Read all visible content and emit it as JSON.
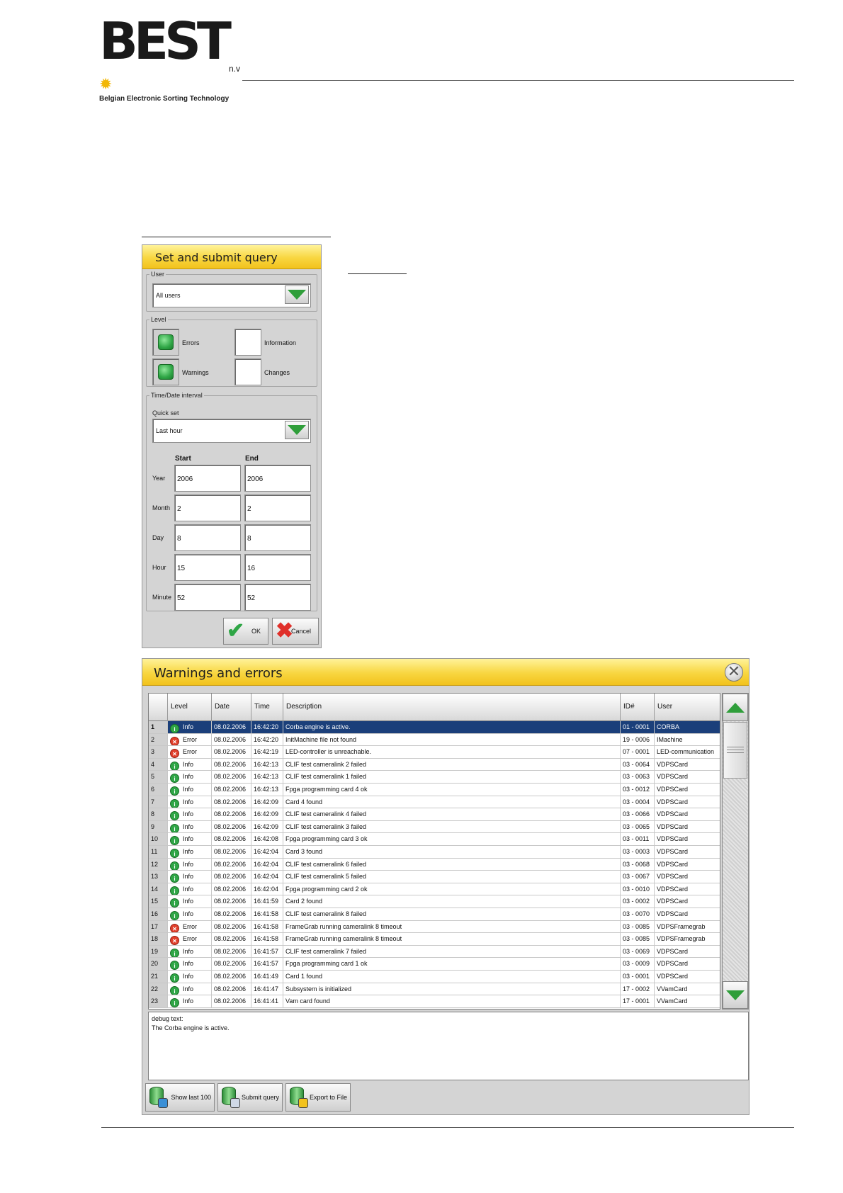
{
  "header": {
    "logo_text": "BEST",
    "logo_suffix": "n.v",
    "tagline": "Belgian Electronic Sorting Technology"
  },
  "query_panel": {
    "title": "Set  and submit query",
    "user_group_label": "User",
    "user_value": "All users",
    "level_group_label": "Level",
    "levels": [
      {
        "label": "Errors",
        "checked": true
      },
      {
        "label": "Information",
        "checked": false
      },
      {
        "label": "Warnings",
        "checked": true
      },
      {
        "label": "Changes",
        "checked": false
      }
    ],
    "interval_group_label": "Time/Date interval",
    "quick_set_label": "Quick set",
    "quick_set_value": "Last hour",
    "start_label": "Start",
    "end_label": "End",
    "rows": [
      {
        "label": "Year",
        "start": "2006",
        "end": "2006"
      },
      {
        "label": "Month",
        "start": "2",
        "end": "2"
      },
      {
        "label": "Day",
        "start": "8",
        "end": "8"
      },
      {
        "label": "Hour",
        "start": "15",
        "end": "16"
      },
      {
        "label": "Minute",
        "start": "52",
        "end": "52"
      }
    ],
    "ok_label": "OK",
    "cancel_label": "Cancel"
  },
  "warnings_panel": {
    "title": "Warnings and errors",
    "columns": [
      "Level",
      "Date",
      "Time",
      "Description",
      "ID#",
      "User"
    ],
    "rows": [
      {
        "n": "1",
        "level": "Info",
        "date": "08.02.2006",
        "time": "16:42:20",
        "desc": "Corba engine is active.",
        "id": "01 - 0001",
        "user": "CORBA"
      },
      {
        "n": "2",
        "level": "Error",
        "date": "08.02.2006",
        "time": "16:42:20",
        "desc": "InitMachine file not found",
        "id": "19 - 0006",
        "user": "IMachine"
      },
      {
        "n": "3",
        "level": "Error",
        "date": "08.02.2006",
        "time": "16:42:19",
        "desc": "LED-controller is unreachable.",
        "id": "07 - 0001",
        "user": "LED-communication"
      },
      {
        "n": "4",
        "level": "Info",
        "date": "08.02.2006",
        "time": "16:42:13",
        "desc": "CLIF test cameralink 2 failed",
        "id": "03 - 0064",
        "user": "VDPSCard"
      },
      {
        "n": "5",
        "level": "Info",
        "date": "08.02.2006",
        "time": "16:42:13",
        "desc": "CLIF test cameralink 1 failed",
        "id": "03 - 0063",
        "user": "VDPSCard"
      },
      {
        "n": "6",
        "level": "Info",
        "date": "08.02.2006",
        "time": "16:42:13",
        "desc": "Fpga programming card 4 ok",
        "id": "03 - 0012",
        "user": "VDPSCard"
      },
      {
        "n": "7",
        "level": "Info",
        "date": "08.02.2006",
        "time": "16:42:09",
        "desc": "Card 4 found",
        "id": "03 - 0004",
        "user": "VDPSCard"
      },
      {
        "n": "8",
        "level": "Info",
        "date": "08.02.2006",
        "time": "16:42:09",
        "desc": "CLIF test cameralink 4 failed",
        "id": "03 - 0066",
        "user": "VDPSCard"
      },
      {
        "n": "9",
        "level": "Info",
        "date": "08.02.2006",
        "time": "16:42:09",
        "desc": "CLIF test cameralink 3 failed",
        "id": "03 - 0065",
        "user": "VDPSCard"
      },
      {
        "n": "10",
        "level": "Info",
        "date": "08.02.2006",
        "time": "16:42:08",
        "desc": "Fpga programming card 3 ok",
        "id": "03 - 0011",
        "user": "VDPSCard"
      },
      {
        "n": "11",
        "level": "Info",
        "date": "08.02.2006",
        "time": "16:42:04",
        "desc": "Card 3 found",
        "id": "03 - 0003",
        "user": "VDPSCard"
      },
      {
        "n": "12",
        "level": "Info",
        "date": "08.02.2006",
        "time": "16:42:04",
        "desc": "CLIF test cameralink 6 failed",
        "id": "03 - 0068",
        "user": "VDPSCard"
      },
      {
        "n": "13",
        "level": "Info",
        "date": "08.02.2006",
        "time": "16:42:04",
        "desc": "CLIF test cameralink 5 failed",
        "id": "03 - 0067",
        "user": "VDPSCard"
      },
      {
        "n": "14",
        "level": "Info",
        "date": "08.02.2006",
        "time": "16:42:04",
        "desc": "Fpga programming card 2 ok",
        "id": "03 - 0010",
        "user": "VDPSCard"
      },
      {
        "n": "15",
        "level": "Info",
        "date": "08.02.2006",
        "time": "16:41:59",
        "desc": "Card 2 found",
        "id": "03 - 0002",
        "user": "VDPSCard"
      },
      {
        "n": "16",
        "level": "Info",
        "date": "08.02.2006",
        "time": "16:41:58",
        "desc": "CLIF test cameralink 8 failed",
        "id": "03 - 0070",
        "user": "VDPSCard"
      },
      {
        "n": "17",
        "level": "Error",
        "date": "08.02.2006",
        "time": "16:41:58",
        "desc": "FrameGrab running cameralink 8 timeout",
        "id": "03 - 0085",
        "user": "VDPSFramegrab"
      },
      {
        "n": "18",
        "level": "Error",
        "date": "08.02.2006",
        "time": "16:41:58",
        "desc": "FrameGrab running cameralink 8 timeout",
        "id": "03 - 0085",
        "user": "VDPSFramegrab"
      },
      {
        "n": "19",
        "level": "Info",
        "date": "08.02.2006",
        "time": "16:41:57",
        "desc": "CLIF test cameralink 7 failed",
        "id": "03 - 0069",
        "user": "VDPSCard"
      },
      {
        "n": "20",
        "level": "Info",
        "date": "08.02.2006",
        "time": "16:41:57",
        "desc": "Fpga programming card 1 ok",
        "id": "03 - 0009",
        "user": "VDPSCard"
      },
      {
        "n": "21",
        "level": "Info",
        "date": "08.02.2006",
        "time": "16:41:49",
        "desc": "Card 1 found",
        "id": "03 - 0001",
        "user": "VDPSCard"
      },
      {
        "n": "22",
        "level": "Info",
        "date": "08.02.2006",
        "time": "16:41:47",
        "desc": "Subsystem is initialized",
        "id": "17 - 0002",
        "user": "VVamCard"
      },
      {
        "n": "23",
        "level": "Info",
        "date": "08.02.2006",
        "time": "16:41:41",
        "desc": "Vam card found",
        "id": "17 - 0001",
        "user": "VVamCard"
      }
    ],
    "selected_row": "1",
    "debug_label": "debug text:",
    "debug_text": "The Corba engine is active.",
    "buttons": [
      "Show last 100",
      "Submit query",
      "Export to File"
    ]
  }
}
